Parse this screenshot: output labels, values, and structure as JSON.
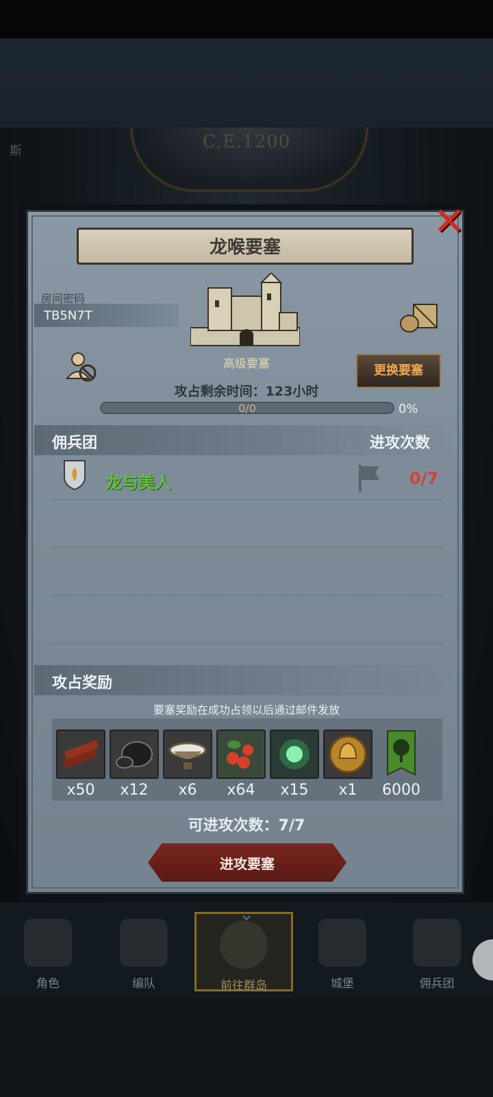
{
  "background": {
    "era": "C.E.1200",
    "left_fragment": "斯"
  },
  "dialog": {
    "title": "龙喉要塞",
    "room_label": "房间密码",
    "room_code": "TB5N7T",
    "fortress_name": "高级要塞",
    "change_button": "更换要塞",
    "time_left": "攻占剩余时间：123小时",
    "progress": {
      "text": "0/0",
      "percent_text": "0%",
      "fraction": 0
    },
    "mercenary_header": "佣兵团",
    "attack_count_header": "进攻次数",
    "mercenaries": [
      {
        "name": "龙与美人",
        "attacks": "0/7"
      }
    ],
    "reward_header": "攻占奖励",
    "reward_note": "要塞奖励在成功占领以后通过邮件发放",
    "rewards": [
      {
        "icon": "wood-planks-icon",
        "qty": "x50"
      },
      {
        "icon": "ore-rock-icon",
        "qty": "x12"
      },
      {
        "icon": "silver-bowl-icon",
        "qty": "x6"
      },
      {
        "icon": "berries-icon",
        "qty": "x64"
      },
      {
        "icon": "green-spirit-icon",
        "qty": "x15"
      },
      {
        "icon": "golden-helmet-medal-icon",
        "qty": "x1"
      },
      {
        "icon": "tree-banner-icon",
        "qty": "6000"
      }
    ],
    "attacks_available": "可进攻次数：7/7",
    "attack_button": "进攻要塞"
  },
  "nav": {
    "items": [
      {
        "label": "角色"
      },
      {
        "label": "编队"
      },
      {
        "label": "前往群岛"
      },
      {
        "label": "城堡"
      },
      {
        "label": "佣兵团"
      }
    ]
  },
  "colors": {
    "merc_name": "#5fc23a",
    "attacks_red": "#d0413a",
    "close_red": "#d42a1e",
    "change_button_text": "#f0a850"
  }
}
